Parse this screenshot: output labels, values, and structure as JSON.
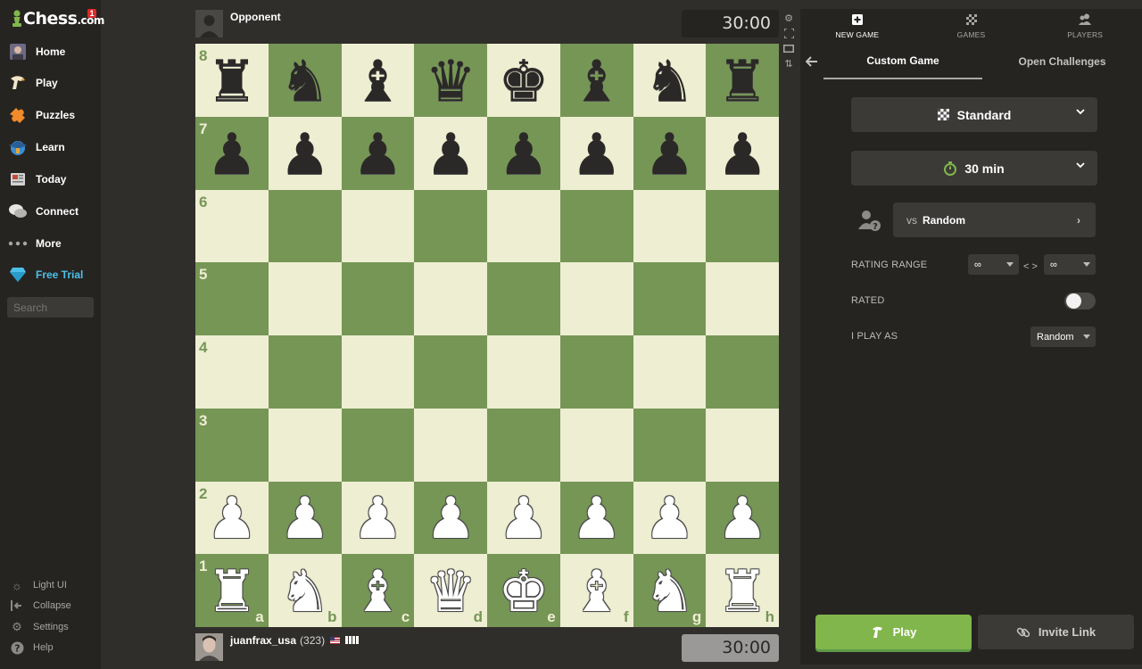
{
  "app": {
    "logo_text": "Chess",
    "logo_suffix": ".com",
    "notification_count": "1"
  },
  "sidebar": {
    "items": [
      {
        "label": "Home",
        "icon": "home-avatar-icon"
      },
      {
        "label": "Play",
        "icon": "play-icon"
      },
      {
        "label": "Puzzles",
        "icon": "puzzle-icon"
      },
      {
        "label": "Learn",
        "icon": "learn-icon"
      },
      {
        "label": "Today",
        "icon": "news-icon"
      },
      {
        "label": "Connect",
        "icon": "chat-icon"
      },
      {
        "label": "More",
        "icon": "more-icon"
      },
      {
        "label": "Free Trial",
        "icon": "diamond-icon"
      }
    ],
    "search_placeholder": "Search",
    "footer": [
      {
        "label": "Light UI",
        "icon": "sun-icon"
      },
      {
        "label": "Collapse",
        "icon": "collapse-icon"
      },
      {
        "label": "Settings",
        "icon": "gear-icon"
      },
      {
        "label": "Help",
        "icon": "help-icon"
      }
    ]
  },
  "game": {
    "opponent": {
      "name": "Opponent",
      "clock": "30:00"
    },
    "player": {
      "name": "juanfrax_usa",
      "rating": "(323)",
      "clock": "30:00"
    },
    "board": {
      "ranks": [
        "8",
        "7",
        "6",
        "5",
        "4",
        "3",
        "2",
        "1"
      ],
      "files": [
        "a",
        "b",
        "c",
        "d",
        "e",
        "f",
        "g",
        "h"
      ],
      "rows": [
        [
          "br",
          "bn",
          "bb",
          "bq",
          "bk",
          "bb",
          "bn",
          "br"
        ],
        [
          "bp",
          "bp",
          "bp",
          "bp",
          "bp",
          "bp",
          "bp",
          "bp"
        ],
        [
          "",
          "",
          "",
          "",
          "",
          "",
          "",
          ""
        ],
        [
          "",
          "",
          "",
          "",
          "",
          "",
          "",
          ""
        ],
        [
          "",
          "",
          "",
          "",
          "",
          "",
          "",
          ""
        ],
        [
          "",
          "",
          "",
          "",
          "",
          "",
          "",
          ""
        ],
        [
          "wp",
          "wp",
          "wp",
          "wp",
          "wp",
          "wp",
          "wp",
          "wp"
        ],
        [
          "wr",
          "wn",
          "wb",
          "wq",
          "wk",
          "wb",
          "wn",
          "wr"
        ]
      ]
    }
  },
  "panel": {
    "tabs": [
      {
        "label": "NEW GAME",
        "icon": "plus-square-icon",
        "active": true
      },
      {
        "label": "GAMES",
        "icon": "board-icon",
        "active": false
      },
      {
        "label": "PLAYERS",
        "icon": "players-icon",
        "active": false
      }
    ],
    "subtabs": [
      {
        "label": "Custom Game",
        "active": true
      },
      {
        "label": "Open Challenges",
        "active": false
      }
    ],
    "variant": "Standard",
    "time_control": "30 min",
    "opponent_vs": "vs",
    "opponent_choice": "Random",
    "rating_range_label": "RATING RANGE",
    "rating_min": "∞",
    "rating_sep": "< >",
    "rating_max": "∞",
    "rated_label": "RATED",
    "rated": false,
    "play_as_label": "I PLAY AS",
    "play_as": "Random",
    "play_button": "Play",
    "invite_button": "Invite Link"
  },
  "colors": {
    "board_light": "#eeeed2",
    "board_dark": "#769656",
    "accent_green": "#81b64c",
    "trial_blue": "#4cc0e8"
  }
}
